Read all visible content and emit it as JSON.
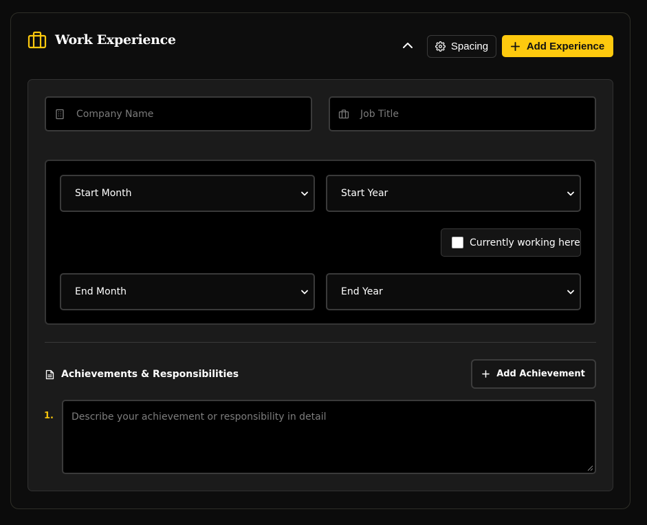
{
  "section": {
    "title": "Work Experience",
    "icon": "briefcase-icon",
    "accent_color": "#fdc90e"
  },
  "toolbar": {
    "collapse_icon": "chevron-up-icon",
    "spacing_label": "Spacing",
    "add_experience_label": "Add Experience"
  },
  "form": {
    "company_placeholder": "Company Name",
    "job_title_placeholder": "Job Title",
    "start_month": "Start Month",
    "start_year": "Start Year",
    "currently_working_label": "Currently working here",
    "currently_working_checked": false,
    "end_month": "End Month",
    "end_year": "End Year"
  },
  "achievements": {
    "title": "Achievements & Responsibilities",
    "add_label": "Add Achievement",
    "items": [
      {
        "number": "1.",
        "placeholder": "Describe your achievement or responsibility in detail"
      }
    ]
  }
}
